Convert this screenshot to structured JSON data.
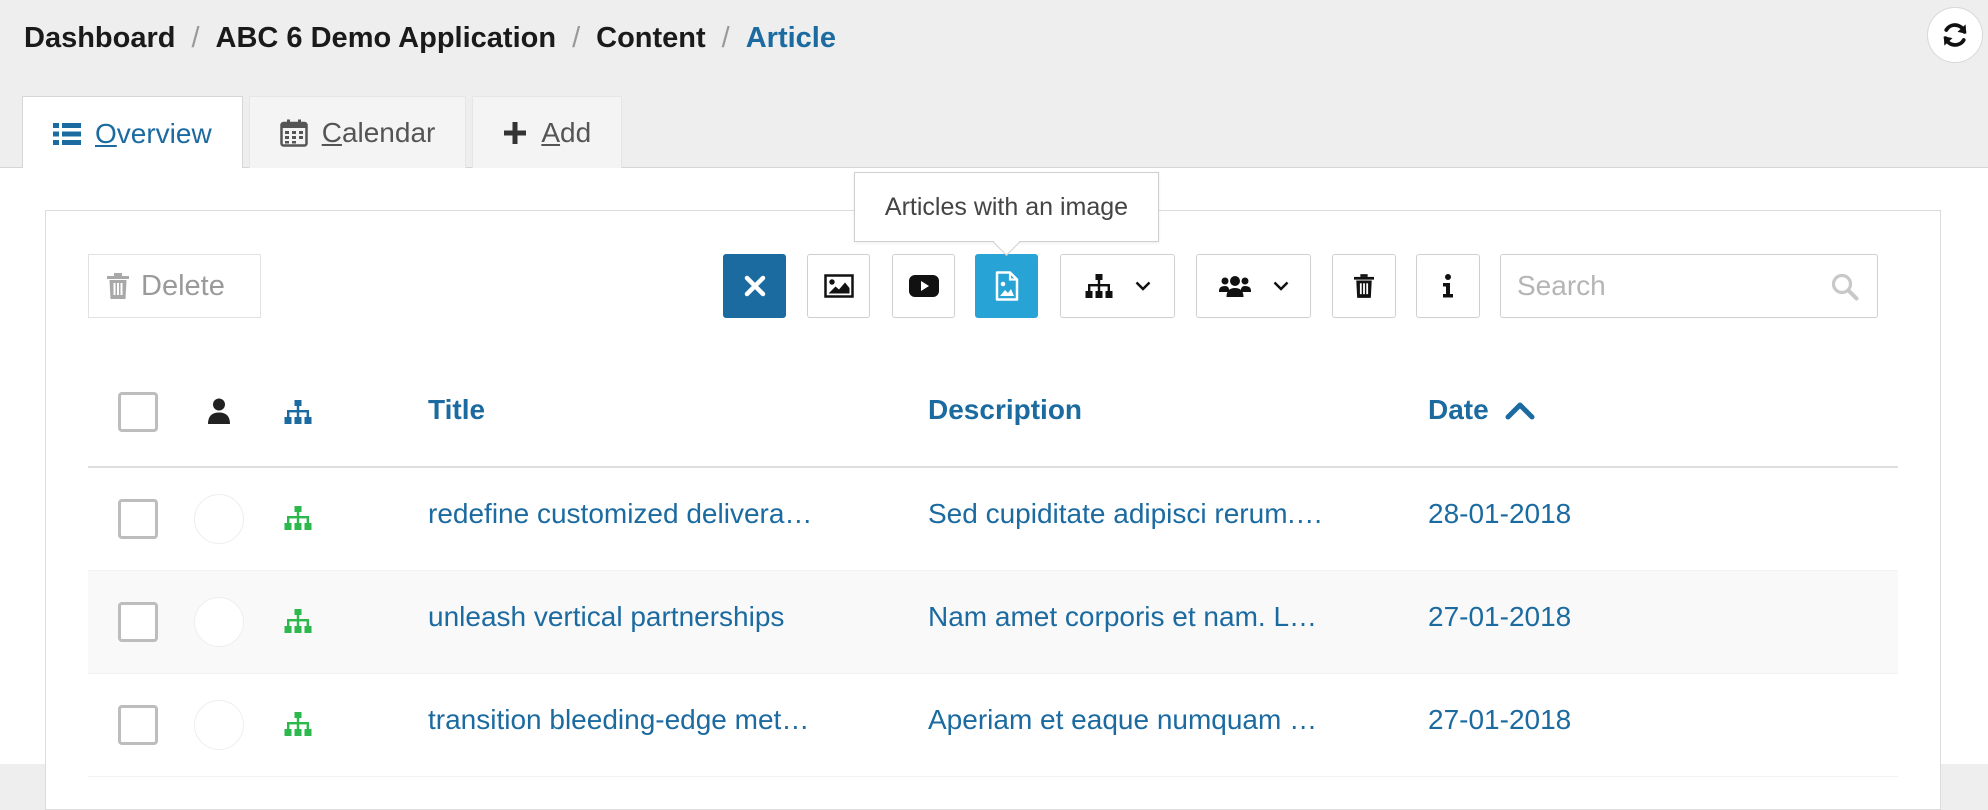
{
  "breadcrumb": {
    "items": [
      "Dashboard",
      "ABC 6 Demo Application",
      "Content"
    ],
    "current": "Article",
    "separator": "/"
  },
  "tabs": [
    {
      "pre": "",
      "accel": "O",
      "post": "verview",
      "icon": "list-icon",
      "active": true
    },
    {
      "pre": "",
      "accel": "C",
      "post": "alendar",
      "icon": "calendar-icon",
      "active": false
    },
    {
      "pre": "",
      "accel": "A",
      "post": "dd",
      "icon": "plus-icon",
      "active": false
    }
  ],
  "toolbar": {
    "delete_label": "Delete",
    "tooltip": "Articles with an image",
    "search_placeholder": "Search"
  },
  "table": {
    "columns": {
      "title": "Title",
      "description": "Description",
      "date": "Date"
    },
    "sort": {
      "column": "date",
      "direction": "ascending"
    },
    "rows": [
      {
        "title": "redefine customized delivera…",
        "description": "Sed cupiditate adipisci rerum.…",
        "date": "28-01-2018"
      },
      {
        "title": "unleash vertical partnerships",
        "description": "Nam amet corporis et nam. L…",
        "date": "27-01-2018"
      },
      {
        "title": "transition bleeding-edge met…",
        "description": "Aperiam et eaque numquam …",
        "date": "27-01-2018"
      }
    ]
  },
  "colors": {
    "accent": "#1b6aa0",
    "active_filter": "#27a3d6",
    "status_green": "#2db84d"
  }
}
